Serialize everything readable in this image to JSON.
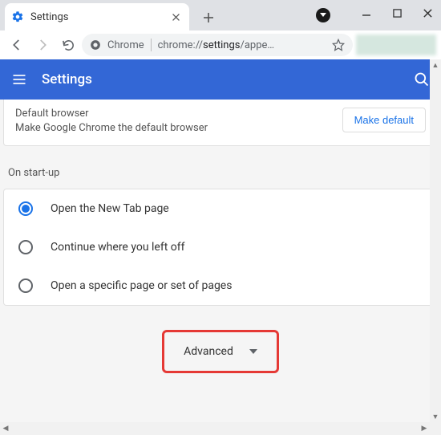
{
  "window": {
    "tab_title": "Settings"
  },
  "address": {
    "chrome_label": "Chrome",
    "url_prefix": "chrome://",
    "url_strong": "settings",
    "url_suffix": "/appe…"
  },
  "bluebar": {
    "title": "Settings"
  },
  "default_browser": {
    "title": "Default browser",
    "subtitle": "Make Google Chrome the default browser",
    "button": "Make default"
  },
  "startup": {
    "heading": "On start-up",
    "options": [
      "Open the New Tab page",
      "Continue where you left off",
      "Open a specific page or set of pages"
    ],
    "selected_index": 0
  },
  "advanced": {
    "label": "Advanced"
  }
}
